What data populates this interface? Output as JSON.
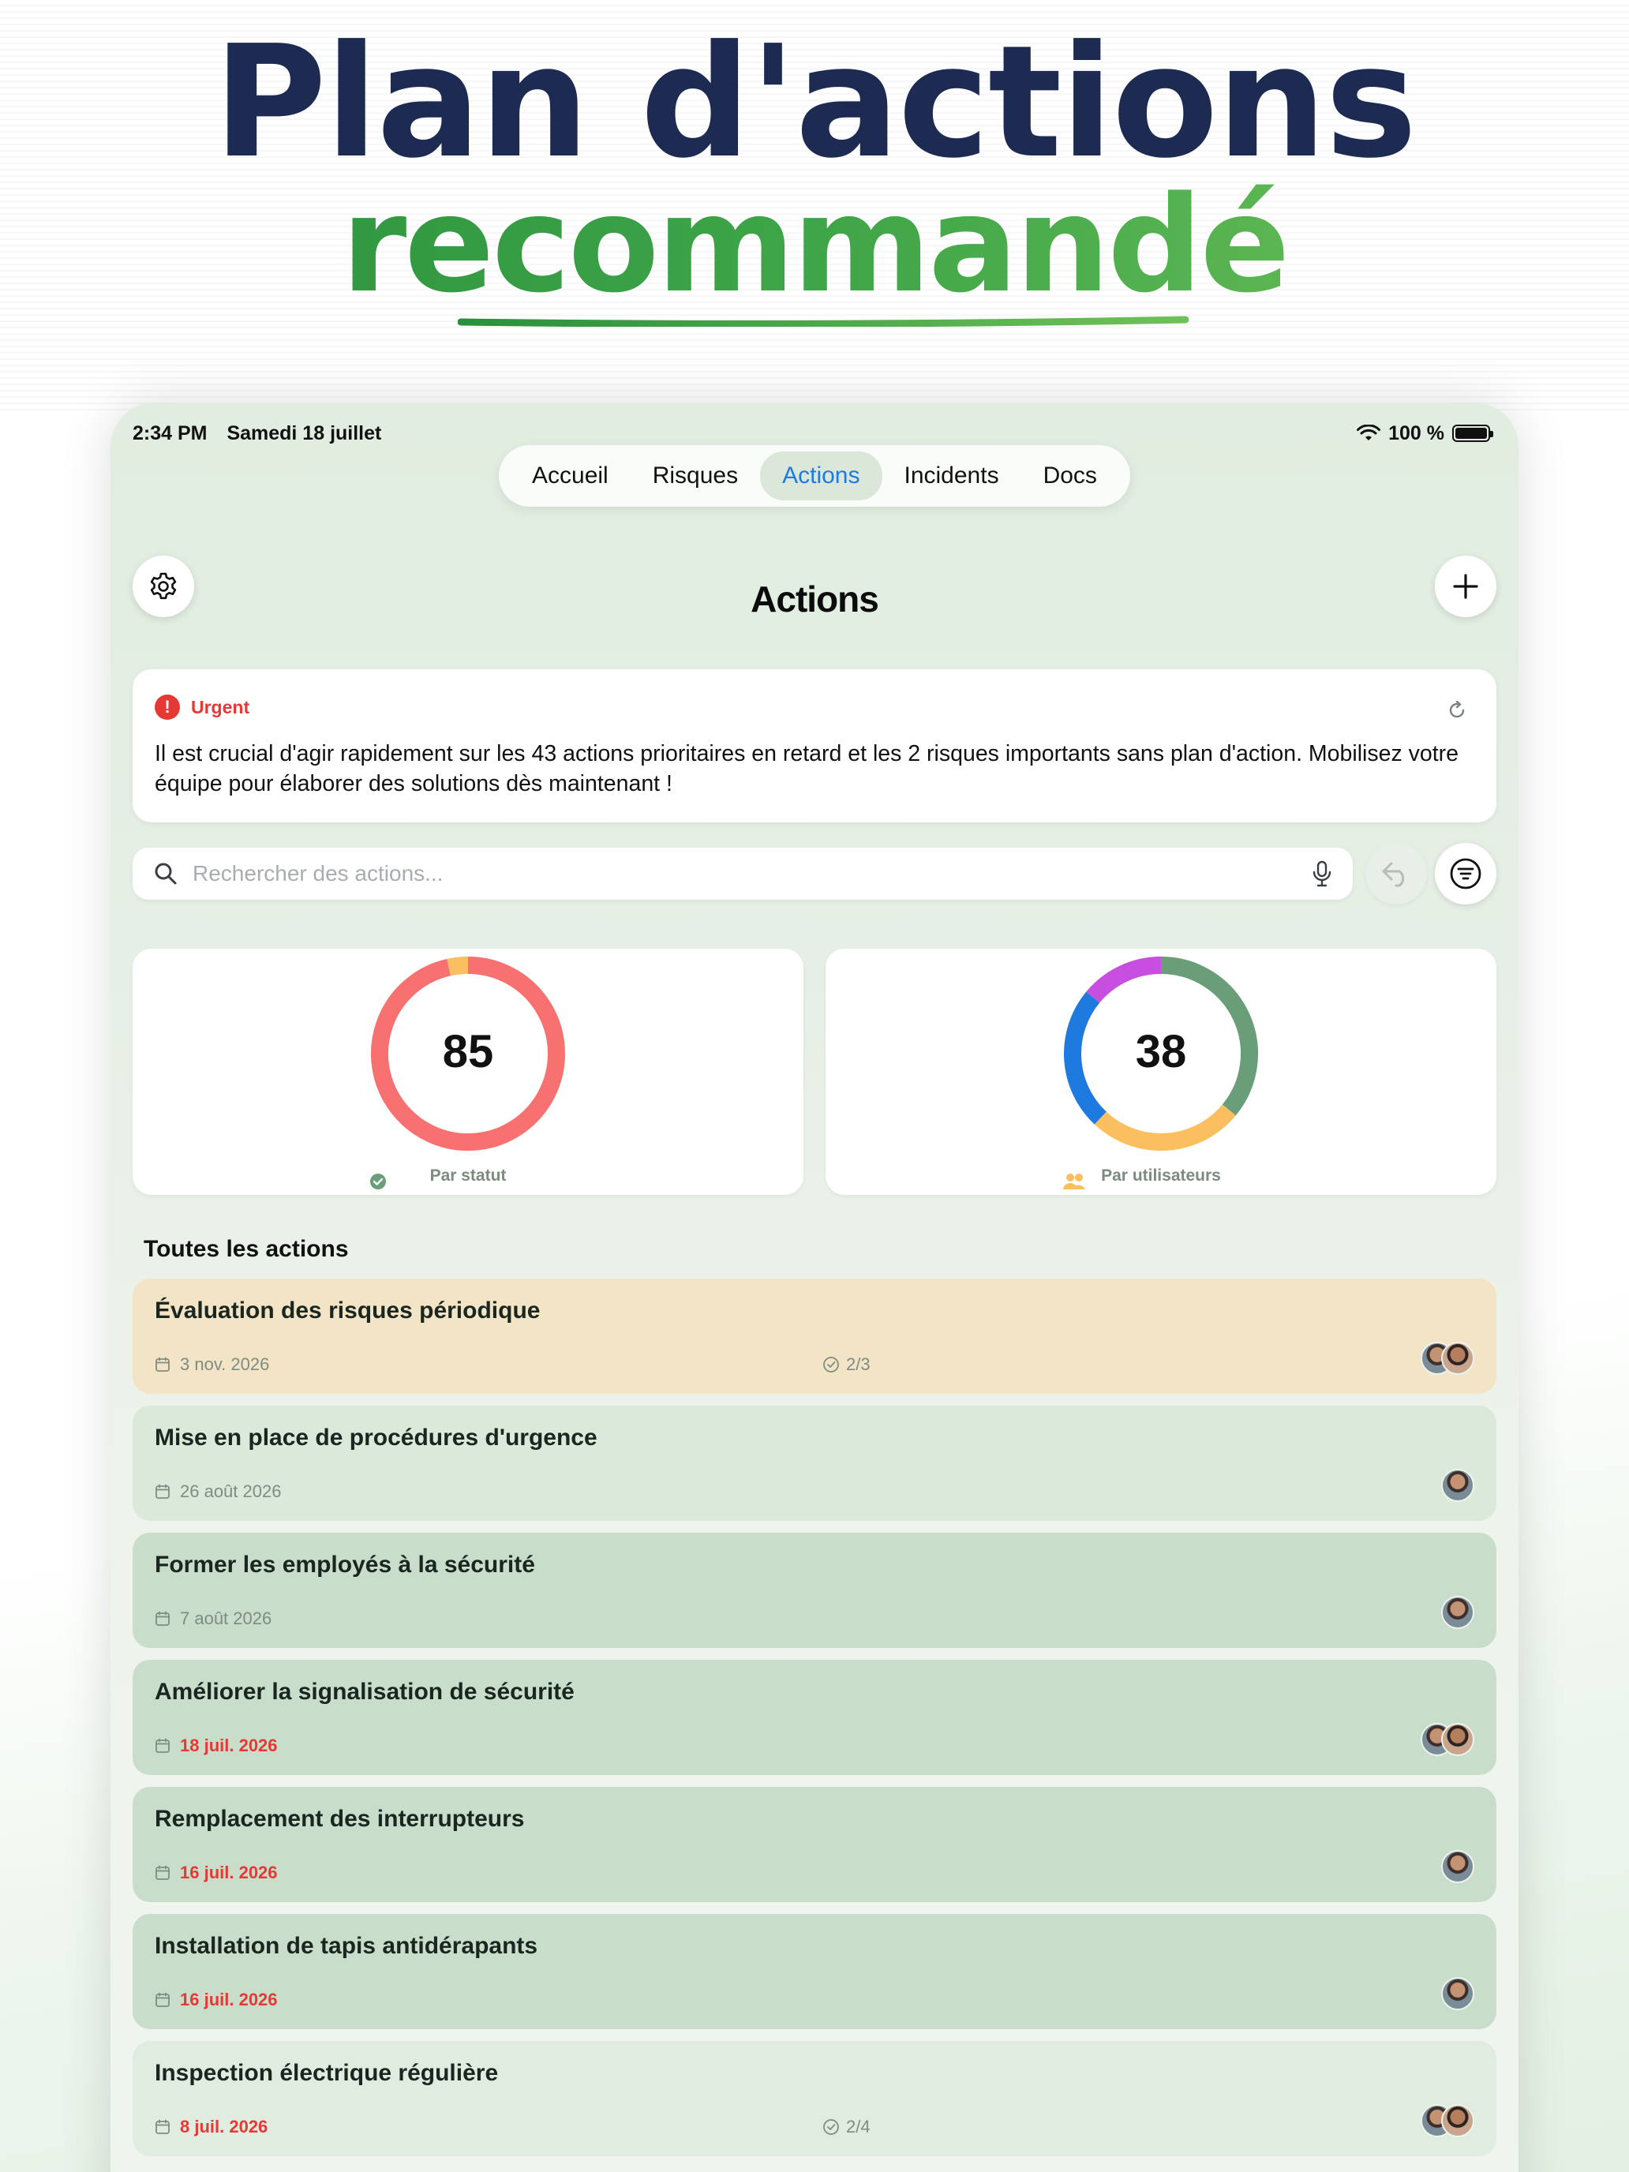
{
  "hero": {
    "title": "Plan d'actions",
    "subtitle": "recommandé"
  },
  "status_bar": {
    "time": "2:34 PM",
    "date": "Samedi 18 juillet",
    "battery": "100 %"
  },
  "tabs": [
    {
      "label": "Accueil",
      "active": false
    },
    {
      "label": "Risques",
      "active": false
    },
    {
      "label": "Actions",
      "active": true
    },
    {
      "label": "Incidents",
      "active": false
    },
    {
      "label": "Docs",
      "active": false
    }
  ],
  "page": {
    "title": "Actions"
  },
  "urgent": {
    "label": "Urgent",
    "text": "Il est crucial d'agir rapidement sur les 43 actions prioritaires en retard et les 2 risques importants sans plan d'action. Mobilisez votre équipe pour élaborer des solutions dès maintenant !"
  },
  "search": {
    "placeholder": "Rechercher des actions..."
  },
  "charts": [
    {
      "value": "85",
      "label": "Par statut",
      "segments": [
        {
          "fraction": 0.965,
          "color": "#f87171"
        },
        {
          "fraction": 0.035,
          "color": "#fbbf5f"
        }
      ]
    },
    {
      "value": "38",
      "label": "Par utilisateurs",
      "segments": [
        {
          "fraction": 0.36,
          "color": "#6a9e78"
        },
        {
          "fraction": 0.26,
          "color": "#fbbf5f"
        },
        {
          "fraction": 0.24,
          "color": "#1f7ae0"
        },
        {
          "fraction": 0.14,
          "color": "#c84ee0"
        }
      ]
    }
  ],
  "section_title": "Toutes les actions",
  "actions": [
    {
      "title": "Évaluation des risques périodique",
      "date": "3 nov. 2026",
      "late": false,
      "progress": "2/3",
      "avatars": 2,
      "bg": "#f3e4c6"
    },
    {
      "title": "Mise en place de procédures d'urgence",
      "date": "26 août 2026",
      "late": false,
      "progress": "",
      "avatars": 1,
      "bg": "#dbe9da"
    },
    {
      "title": "Former les employés à la sécurité",
      "date": "7 août 2026",
      "late": false,
      "progress": "",
      "avatars": 1,
      "bg": "#c9ddcb"
    },
    {
      "title": "Améliorer la signalisation de sécurité",
      "date": "18 juil. 2026",
      "late": true,
      "progress": "",
      "avatars": 2,
      "bg": "#c9ddcb"
    },
    {
      "title": "Remplacement des interrupteurs",
      "date": "16 juil. 2026",
      "late": true,
      "progress": "",
      "avatars": 1,
      "bg": "#c9ddcb"
    },
    {
      "title": "Installation de tapis antidérapants",
      "date": "16 juil. 2026",
      "late": true,
      "progress": "",
      "avatars": 1,
      "bg": "#c9ddcb"
    },
    {
      "title": "Inspection électrique régulière",
      "date": "8 juil. 2026",
      "late": true,
      "progress": "2/4",
      "avatars": 2,
      "bg": "#e1ece0"
    }
  ]
}
